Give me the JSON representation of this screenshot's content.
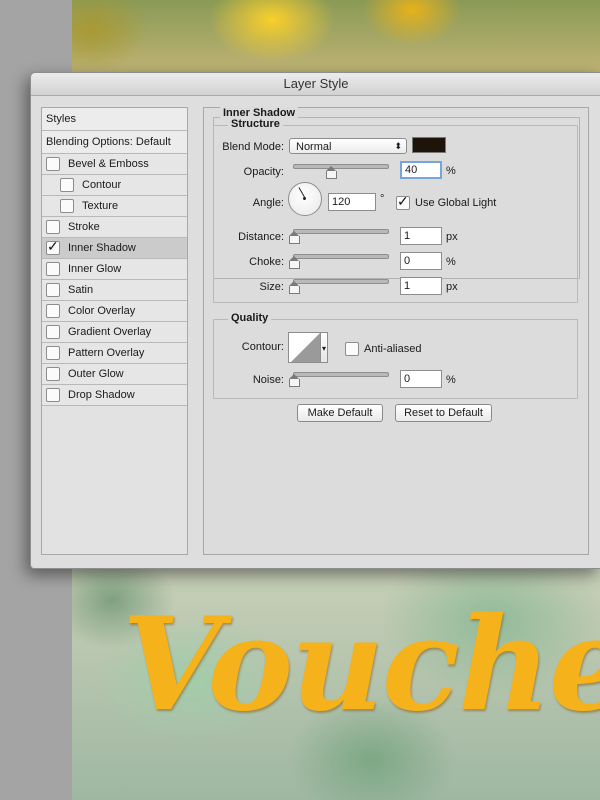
{
  "dialog": {
    "title": "Layer Style"
  },
  "styles_panel": {
    "header": "Styles",
    "blending": "Blending Options: Default",
    "items": [
      {
        "label": "Bevel & Emboss",
        "checked": false
      },
      {
        "label": "Contour",
        "checked": false
      },
      {
        "label": "Texture",
        "checked": false
      },
      {
        "label": "Stroke",
        "checked": false
      },
      {
        "label": "Inner Shadow",
        "checked": true
      },
      {
        "label": "Inner Glow",
        "checked": false
      },
      {
        "label": "Satin",
        "checked": false
      },
      {
        "label": "Color Overlay",
        "checked": false
      },
      {
        "label": "Gradient Overlay",
        "checked": false
      },
      {
        "label": "Pattern Overlay",
        "checked": false
      },
      {
        "label": "Outer Glow",
        "checked": false
      },
      {
        "label": "Drop Shadow",
        "checked": false
      }
    ]
  },
  "inner_shadow": {
    "title": "Inner Shadow",
    "structure": {
      "title": "Structure",
      "blend_mode_label": "Blend Mode:",
      "blend_mode_value": "Normal",
      "shadow_color": "#1f1409",
      "opacity_label": "Opacity:",
      "opacity_value": "40",
      "opacity_unit": "%",
      "opacity_slider": 0.4,
      "angle_label": "Angle:",
      "angle_value": "120",
      "angle_unit": "°",
      "global_light_label": "Use Global Light",
      "global_light_checked": true,
      "distance_label": "Distance:",
      "distance_value": "1",
      "distance_unit": "px",
      "distance_slider": 0.0,
      "choke_label": "Choke:",
      "choke_value": "0",
      "choke_unit": "%",
      "choke_slider": 0.0,
      "size_label": "Size:",
      "size_value": "1",
      "size_unit": "px",
      "size_slider": 0.0
    },
    "quality": {
      "title": "Quality",
      "contour_label": "Contour:",
      "anti_aliased_label": "Anti-aliased",
      "anti_aliased_checked": false,
      "noise_label": "Noise:",
      "noise_value": "0",
      "noise_unit": "%",
      "noise_slider": 0.0
    },
    "make_default": "Make Default",
    "reset_default": "Reset to Default"
  },
  "canvas": {
    "text": "Voucher"
  }
}
